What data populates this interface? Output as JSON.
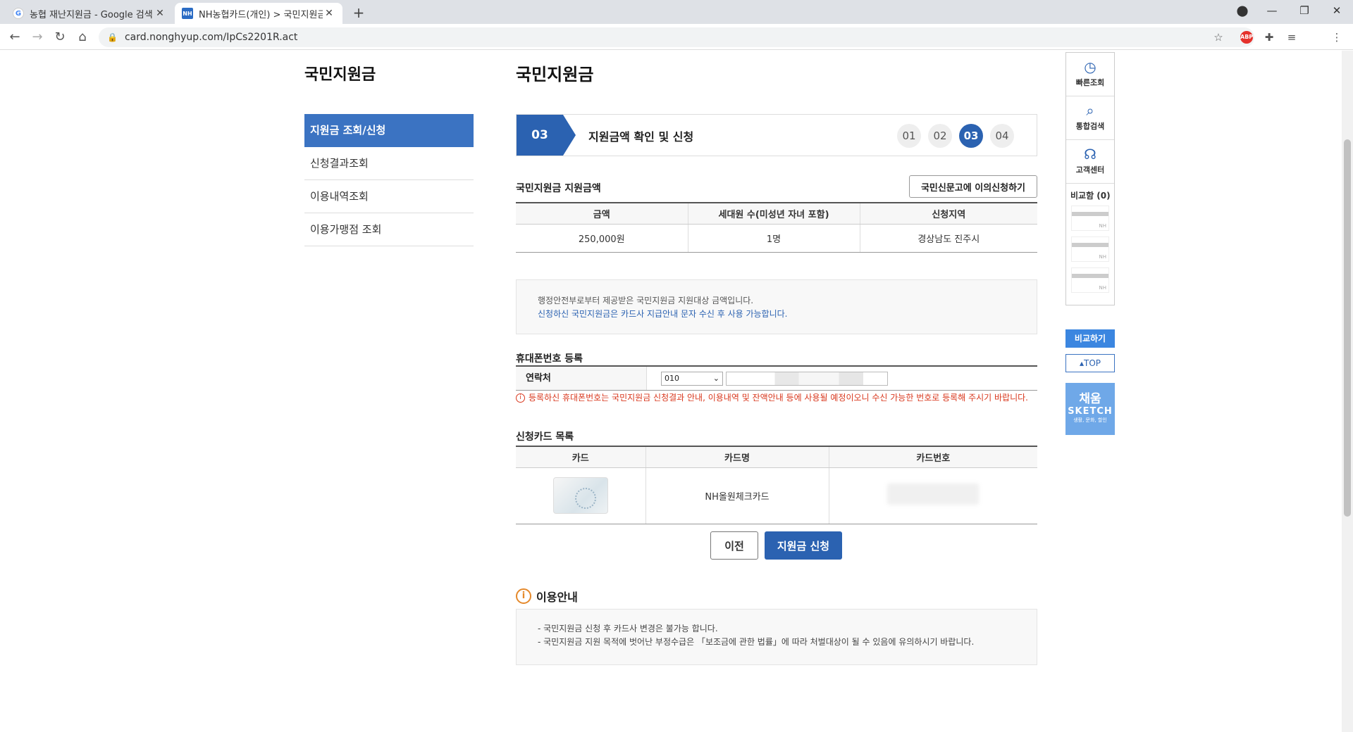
{
  "browser": {
    "tabs": [
      {
        "favicon": "G",
        "title": "농협 재난지원금 - Google 검색",
        "close": "✕"
      },
      {
        "favicon": "NH",
        "title": "NH농협카드(개인) > 국민지원금",
        "close": "✕"
      }
    ],
    "new_tab": "+",
    "url": "card.nonghyup.com/IpCs2201R.act",
    "adblock_label": "ABP"
  },
  "sidebar": {
    "title": "국민지원금",
    "items": [
      {
        "label": "지원금 조회/신청"
      },
      {
        "label": "신청결과조회"
      },
      {
        "label": "이용내역조회"
      },
      {
        "label": "이용가맹점 조회"
      }
    ]
  },
  "main": {
    "title": "국민지원금",
    "step": {
      "current": "03",
      "label": "지원금액 확인 및 신청",
      "steps": [
        "01",
        "02",
        "03",
        "04"
      ]
    },
    "amount_section": {
      "title": "국민지원금 지원금액",
      "objection_button": "국민신문고에 이의신청하기",
      "headers": [
        "금액",
        "세대원 수(미성년 자녀 포함)",
        "신청지역"
      ],
      "row": [
        "250,000원",
        "1명",
        "경상남도 진주시"
      ]
    },
    "info": {
      "line1": "행정안전부로부터 제공받은 국민지원금 지원대상 금액입니다.",
      "line2": "신청하신 국민지원금은 카드사 지급안내 문자 수신 후 사용 가능합니다."
    },
    "phone_section": {
      "title": "휴대폰번호 등록",
      "label": "연락처",
      "prefix_value": "010",
      "warning": "등록하신 휴대폰번호는 국민지원금 신청결과 안내, 이용내역 및 잔액안내 등에 사용될 예정이오니 수신 가능한 번호로 등록해 주시기 바랍니다."
    },
    "card_section": {
      "title": "신청카드 목록",
      "headers": [
        "카드",
        "카드명",
        "카드번호"
      ],
      "row": {
        "card_name": "NH올원체크카드"
      }
    },
    "buttons": {
      "prev": "이전",
      "apply": "지원금 신청"
    },
    "guide": {
      "title": "이용안내",
      "lines": [
        "- 국민지원금 신청 후 카드사 변경은 불가능 합니다.",
        "- 국민지원금 지원 목적에 벗어난 부정수급은 「보조금에 관한 법률」에 따라 처벌대상이 될 수 있음에 유의하시기 바랍니다."
      ]
    }
  },
  "quickbar": {
    "items": [
      {
        "label": "빠른조회",
        "icon": "clock-icon"
      },
      {
        "label": "통합검색",
        "icon": "search-icon"
      },
      {
        "label": "고객센터",
        "icon": "headset-icon"
      }
    ],
    "compare_label": "비교함 (0)",
    "slot_label": "NH",
    "compare_button": "비교하기",
    "top_button": "TOP",
    "banner": {
      "line1": "채움",
      "line2": "SKETCH",
      "line3": "생활, 문화, 할인"
    }
  },
  "colors": {
    "primary": "#2b62b1",
    "warning": "#d9381e",
    "accent": "#e5892b"
  }
}
